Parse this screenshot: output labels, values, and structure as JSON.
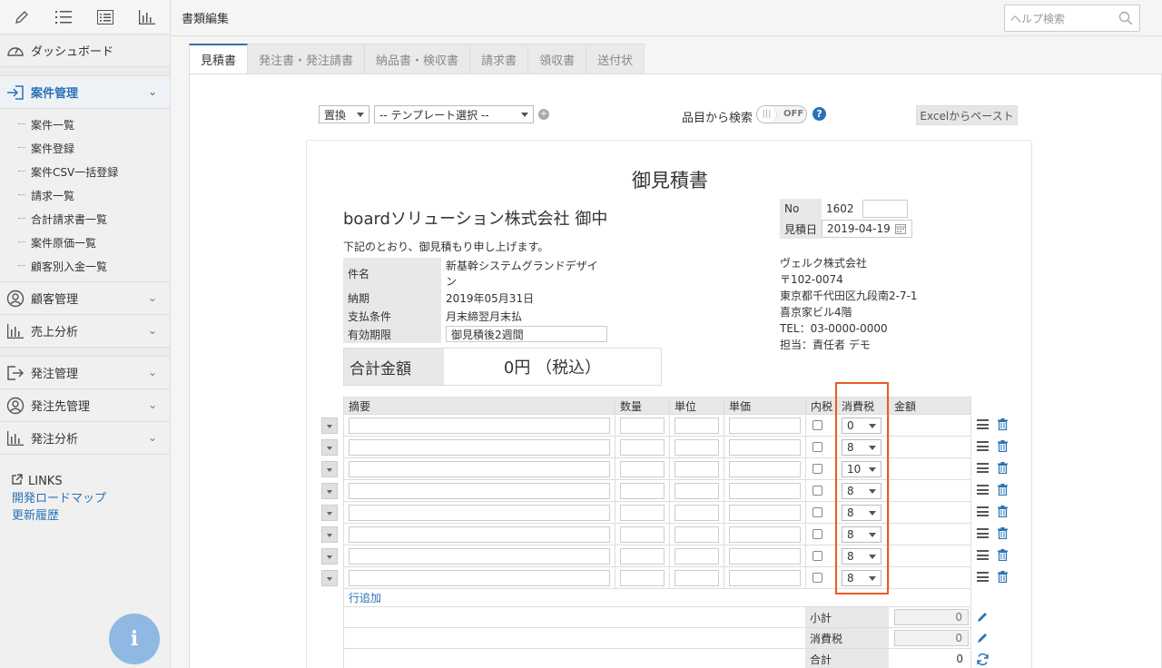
{
  "header": {
    "title": "書類編集",
    "help_placeholder": "ヘルプ検索"
  },
  "sidebar": {
    "top_icons": [
      "pencil-icon",
      "list-icon",
      "checklist-icon",
      "bar-chart-icon"
    ],
    "dashboard": "ダッシュボード",
    "case_mgmt": "案件管理",
    "sub_items": [
      "案件一覧",
      "案件登録",
      "案件CSV一括登録",
      "請求一覧",
      "合計請求書一覧",
      "案件原価一覧",
      "顧客別入金一覧"
    ],
    "customer_mgmt": "顧客管理",
    "sales_analysis": "売上分析",
    "order_mgmt": "発注管理",
    "supplier_mgmt": "発注先管理",
    "order_analysis": "発注分析",
    "links_heading": "LINKS",
    "link_roadmap": "開発ロードマップ",
    "link_history": "更新履歴",
    "info_label": "i"
  },
  "tabs": [
    "見積書",
    "発注書・発注請書",
    "納品書・検収書",
    "請求書",
    "領収書",
    "送付状"
  ],
  "toolbar": {
    "replace_select": "置換",
    "template_select": "-- テンプレート選択 --",
    "search_label": "品目から検索",
    "toggle_state": "OFF",
    "excel_button": "Excelからペースト"
  },
  "document": {
    "title": "御見積書",
    "client": "boardソリューション株式会社 御中",
    "greeting": "下記のとおり、御見積もり申し上げます。",
    "meta": [
      {
        "key": "件名",
        "value": "新基幹システムグランドデザイン"
      },
      {
        "key": "納期",
        "value": "2019年05月31日"
      },
      {
        "key": "支払条件",
        "value": "月末締翌月末払"
      },
      {
        "key": "有効期限",
        "value": "御見積後2週間"
      }
    ],
    "total_label": "合計金額",
    "total_value": "0円 （税込）",
    "no_label": "No",
    "no_value": "1602",
    "date_label": "見積日",
    "date_value": "2019-04-19",
    "company": {
      "name": "ヴェルク株式会社",
      "zip": "〒102-0074",
      "address": "東京都千代田区九段南2-7-1",
      "building": "喜京家ビル4階",
      "tel": "TEL：03-0000-0000",
      "person": "担当：責任者 デモ"
    }
  },
  "items": {
    "headers": [
      "摘要",
      "数量",
      "単位",
      "単価",
      "内税",
      "消費税",
      "金額"
    ],
    "tax_rates": [
      "0",
      "8",
      "10",
      "8",
      "8",
      "8",
      "8",
      "8"
    ],
    "add_row": "行追加",
    "subtotal_label": "小計",
    "subtotal_value": "0",
    "tax_label": "消費税",
    "tax_value": "0",
    "total_label": "合計",
    "total_value": "0"
  },
  "colors": {
    "accent": "#2a72b5",
    "highlight": "#ea5b23"
  }
}
